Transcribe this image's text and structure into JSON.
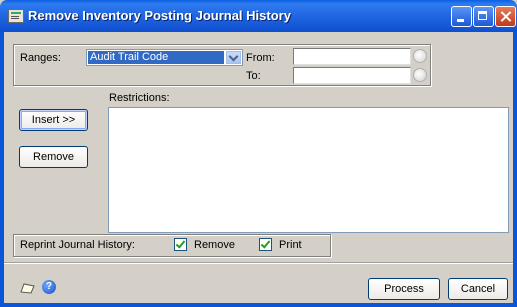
{
  "window": {
    "title": "Remove Inventory Posting Journal History"
  },
  "ranges": {
    "label": "Ranges:",
    "selected": "Audit Trail Code",
    "from_label": "From:",
    "to_label": "To:",
    "from_value": "",
    "to_value": ""
  },
  "restrictions": {
    "label": "Restrictions:"
  },
  "buttons": {
    "insert": "Insert >>",
    "remove": "Remove",
    "process": "Process",
    "cancel": "Cancel"
  },
  "reprint": {
    "label": "Reprint Journal History:",
    "remove_label": "Remove",
    "remove_checked": true,
    "print_label": "Print",
    "print_checked": true
  },
  "icons": {
    "note": "note-icon",
    "help": "help-icon",
    "lookup": "lookup-icon"
  },
  "colors": {
    "titlebar": "#0a5fe0",
    "window_bg": "#d4d0c8",
    "selection": "#316ac5"
  }
}
